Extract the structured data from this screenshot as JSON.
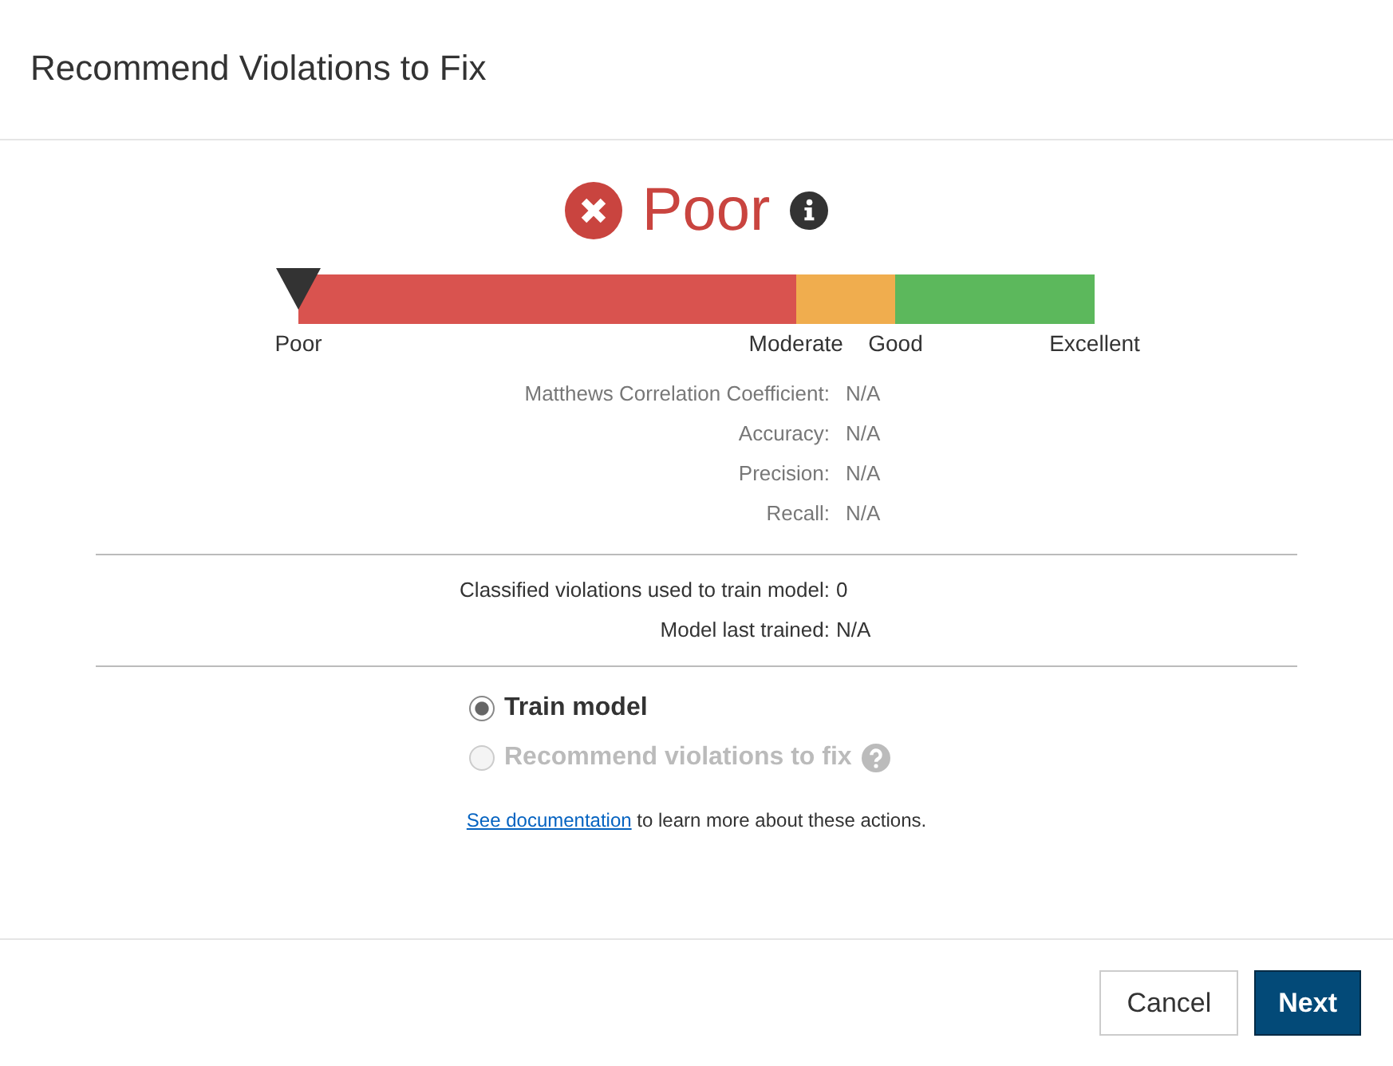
{
  "dialog": {
    "title": "Recommend Violations to Fix"
  },
  "rating": {
    "label": "Poor"
  },
  "scale": {
    "segments": [
      {
        "color": "#d9534f"
      },
      {
        "color": "#f0ad4e"
      },
      {
        "color": "#5cb85c"
      }
    ],
    "labels": [
      "Poor",
      "Moderate",
      "Good",
      "Excellent"
    ],
    "marker": {
      "level": 0
    }
  },
  "metrics": [
    {
      "label": "Matthews Correlation Coefficient:",
      "value": "N/A"
    },
    {
      "label": "Accuracy:",
      "value": "N/A"
    },
    {
      "label": "Precision:",
      "value": "N/A"
    },
    {
      "label": "Recall:",
      "value": "N/A"
    }
  ],
  "training": [
    {
      "label": "Classified violations used to train model:",
      "value": "0"
    },
    {
      "label": "Model last trained:",
      "value": "N/A"
    }
  ],
  "actions": [
    {
      "label": "Train model",
      "selected": true,
      "disabled": false,
      "help": false
    },
    {
      "label": "Recommend violations to fix",
      "selected": false,
      "disabled": true,
      "help": true
    }
  ],
  "note": {
    "link": "See documentation",
    "text": " to learn more about these actions."
  },
  "buttons": [
    {
      "label": "Cancel",
      "kind": "secondary"
    },
    {
      "label": "Next",
      "kind": "primary"
    }
  ]
}
